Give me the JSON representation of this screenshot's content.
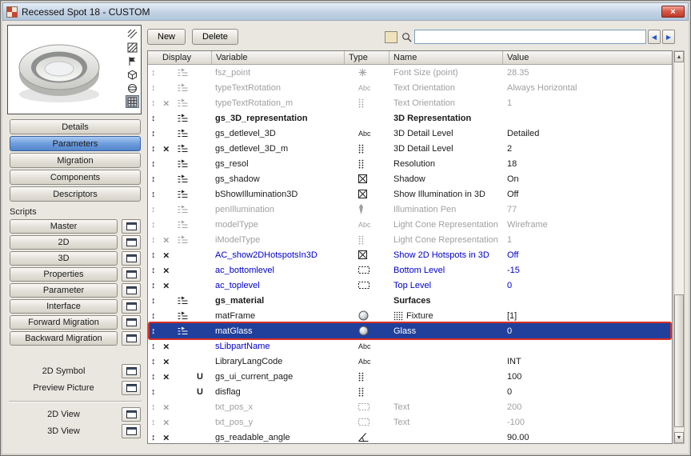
{
  "window": {
    "title": "Recessed Spot 18 - CUSTOM"
  },
  "toolbar": {
    "new_label": "New",
    "delete_label": "Delete",
    "search_value": ""
  },
  "sidebar": {
    "nav_buttons": [
      {
        "label": "Details",
        "selected": false
      },
      {
        "label": "Parameters",
        "selected": true
      },
      {
        "label": "Migration",
        "selected": false
      },
      {
        "label": "Components",
        "selected": false
      },
      {
        "label": "Descriptors",
        "selected": false
      }
    ],
    "scripts_label": "Scripts",
    "script_buttons": [
      "Master",
      "2D",
      "3D",
      "Properties",
      "Parameter",
      "Interface",
      "Forward Migration",
      "Backward Migration"
    ],
    "extra_items": [
      "2D Symbol",
      "Preview Picture"
    ],
    "view_items": [
      "2D View",
      "3D View"
    ],
    "preview_tools": [
      {
        "icon": "hatch-lines-icon",
        "pressed": false
      },
      {
        "icon": "hatch-square-icon",
        "pressed": false
      },
      {
        "icon": "flag-icon",
        "pressed": false
      },
      {
        "icon": "box-icon",
        "pressed": false
      },
      {
        "icon": "sphere-icon",
        "pressed": false
      },
      {
        "icon": "grid-icon",
        "pressed": true
      }
    ]
  },
  "table": {
    "columns": [
      "Display",
      "Variable",
      "Type",
      "Name",
      "Value"
    ],
    "rows": [
      {
        "display": [
          "updown",
          "display"
        ],
        "variable": "fsz_point",
        "type": "font-size",
        "name": "Font Size (point)",
        "value": "28.35",
        "style": "gray"
      },
      {
        "display": [
          "updown",
          "display"
        ],
        "variable": "typeTextRotation",
        "type": "text",
        "name": "Text Orientation",
        "value": "Always Horizontal",
        "style": "gray"
      },
      {
        "display": [
          "updown",
          "x",
          "display"
        ],
        "variable": "typeTextRotation_m",
        "type": "integer",
        "name": "Text Orientation",
        "value": "1",
        "style": "gray"
      },
      {
        "display": [
          "updown",
          "display"
        ],
        "variable": "gs_3D_representation",
        "type": "",
        "name": "3D Representation",
        "value": "",
        "style": "bold"
      },
      {
        "display": [
          "updown",
          "display"
        ],
        "variable": "gs_detlevel_3D",
        "type": "text",
        "name": "3D Detail Level",
        "value": "Detailed",
        "style": "normal"
      },
      {
        "display": [
          "updown",
          "x",
          "display"
        ],
        "variable": "gs_detlevel_3D_m",
        "type": "integer",
        "name": "3D Detail Level",
        "value": "2",
        "style": "normal"
      },
      {
        "display": [
          "updown",
          "display"
        ],
        "variable": "gs_resol",
        "type": "integer",
        "name": "Resolution",
        "value": "18",
        "style": "normal"
      },
      {
        "display": [
          "updown",
          "display"
        ],
        "variable": "gs_shadow",
        "type": "checkbox",
        "name": "Shadow",
        "value": "On",
        "style": "normal"
      },
      {
        "display": [
          "updown",
          "display"
        ],
        "variable": "bShowIllumination3D",
        "type": "checkbox",
        "name": "Show Illumination in 3D",
        "value": "Off",
        "style": "normal"
      },
      {
        "display": [
          "updown",
          "display"
        ],
        "variable": "penIllumination",
        "type": "pen",
        "name": "Illumination Pen",
        "value": "77",
        "style": "gray"
      },
      {
        "display": [
          "updown",
          "display"
        ],
        "variable": "modelType",
        "type": "text",
        "name": "Light Cone Representation",
        "value": "Wireframe",
        "style": "gray"
      },
      {
        "display": [
          "updown",
          "x",
          "display"
        ],
        "variable": "iModelType",
        "type": "integer",
        "name": "Light Cone Representation",
        "value": "1",
        "style": "gray"
      },
      {
        "display": [
          "updown",
          "x"
        ],
        "variable": "AC_show2DHotspotsIn3D",
        "type": "checkbox",
        "name": "Show 2D Hotspots in 3D",
        "value": "Off",
        "style": "blue"
      },
      {
        "display": [
          "updown",
          "x"
        ],
        "variable": "ac_bottomlevel",
        "type": "length",
        "name": "Bottom Level",
        "value": "-15",
        "style": "blue"
      },
      {
        "display": [
          "updown",
          "x"
        ],
        "variable": "ac_toplevel",
        "type": "length",
        "name": "Top Level",
        "value": "0",
        "style": "blue"
      },
      {
        "display": [
          "updown",
          "display"
        ],
        "variable": "gs_material",
        "type": "",
        "name": "Surfaces",
        "value": "",
        "style": "bold"
      },
      {
        "display": [
          "updown",
          "display"
        ],
        "variable": "matFrame",
        "type": "material",
        "name": "Fixture",
        "name_icon": "dots-grid",
        "value": "[1]",
        "style": "normal"
      },
      {
        "display": [
          "updown",
          "display"
        ],
        "variable": "matGlass",
        "type": "material",
        "name": "Glass",
        "value": "0",
        "style": "normal",
        "selected": true
      },
      {
        "display": [
          "updown",
          "x"
        ],
        "variable": "sLibpartName",
        "type": "text",
        "name": "",
        "value": "",
        "style": "blue"
      },
      {
        "display": [
          "updown",
          "x"
        ],
        "variable": "LibraryLangCode",
        "type": "text",
        "name": "",
        "value": "INT",
        "style": "normal"
      },
      {
        "display": [
          "updown",
          "x",
          "uparam"
        ],
        "variable": "gs_ui_current_page",
        "type": "integer",
        "name": "",
        "value": "100",
        "style": "normal"
      },
      {
        "display": [
          "updown",
          "uparam"
        ],
        "variable": "disflag",
        "type": "integer",
        "name": "",
        "value": "0",
        "style": "normal"
      },
      {
        "display": [
          "updown",
          "x"
        ],
        "variable": "txt_pos_x",
        "type": "length",
        "name": "Text",
        "value": "200",
        "style": "gray"
      },
      {
        "display": [
          "updown",
          "x"
        ],
        "variable": "txt_pos_y",
        "type": "length",
        "name": "Text",
        "value": "-100",
        "style": "gray"
      },
      {
        "display": [
          "updown",
          "x"
        ],
        "variable": "gs_readable_angle",
        "type": "angle",
        "name": "",
        "value": "90.00",
        "style": "normal"
      }
    ]
  },
  "colors": {
    "selected_row_bg": "#20409b",
    "selection_outline": "#d93025",
    "param_blue": "#0000cd",
    "disabled_gray": "#a0a0a0",
    "selected_nav_blue": "#6e9edd",
    "close_button_red": "#bf3a28"
  }
}
